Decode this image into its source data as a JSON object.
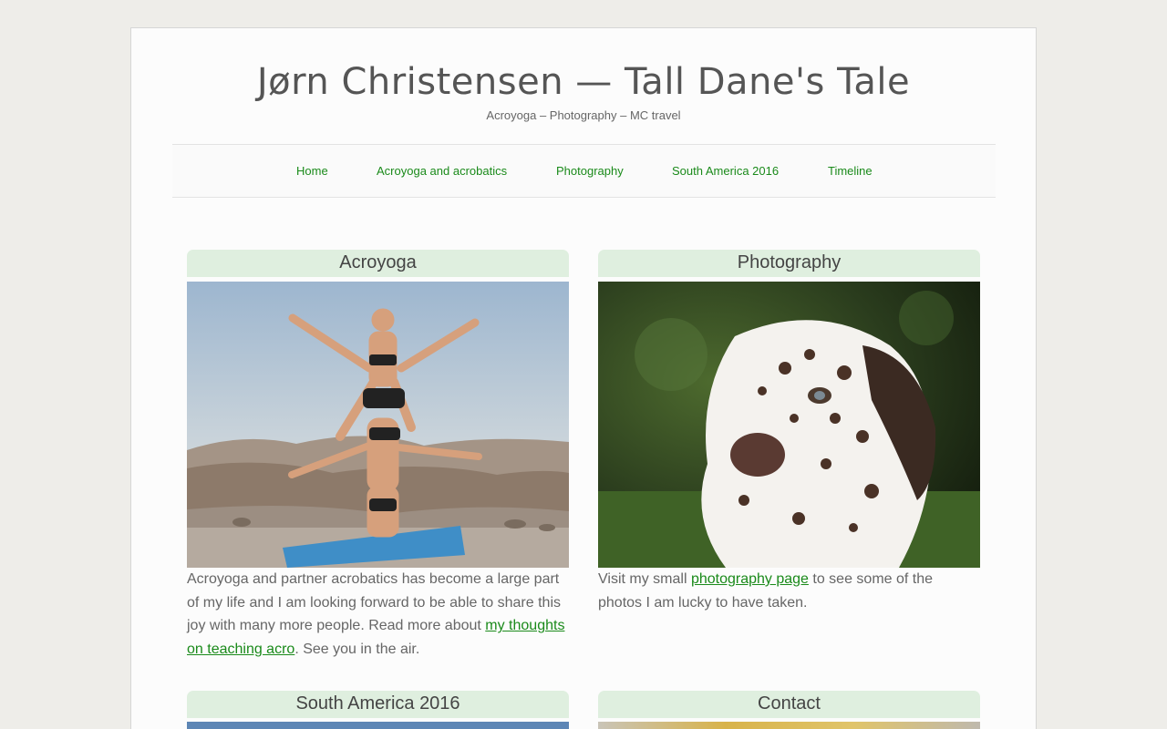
{
  "header": {
    "title": "Jørn Christensen — Tall Dane's Tale",
    "tagline": "Acroyoga – Photography – MC travel"
  },
  "nav": {
    "items": [
      {
        "label": "Home"
      },
      {
        "label": "Acroyoga and acrobatics"
      },
      {
        "label": "Photography"
      },
      {
        "label": "South America 2016"
      },
      {
        "label": "Timeline"
      }
    ]
  },
  "cards": {
    "acroyoga": {
      "title": "Acroyoga",
      "text_before": "Acroyoga and partner acrobatics has become a large part of my life and I am looking forward to be able to share this joy with many more people. Read more about ",
      "link": "my thoughts on teaching acro",
      "text_after": ". See you in the air."
    },
    "photography": {
      "title": "Photography",
      "text_before": "Visit my small ",
      "link": "photography page",
      "text_after": " to see some of the photos I am lucky to have taken."
    },
    "south_america": {
      "title": "South America 2016"
    },
    "contact": {
      "title": "Contact"
    }
  },
  "colors": {
    "link": "#1a8a1a",
    "card_header_bg": "#dfefdf",
    "page_bg": "#eeede9"
  }
}
